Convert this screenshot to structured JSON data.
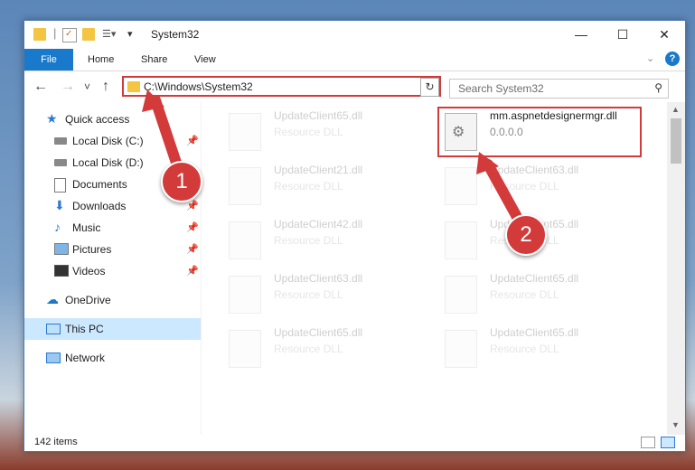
{
  "window": {
    "title": "System32",
    "controls": {
      "minimize": "—",
      "maximize": "☐",
      "close": "✕"
    }
  },
  "ribbon": {
    "file": "File",
    "tabs": [
      "Home",
      "Share",
      "View"
    ]
  },
  "nav": {
    "back": "←",
    "forward": "→",
    "recent": "˅",
    "up": "↑",
    "address": "C:\\Windows\\System32",
    "refresh": "↻",
    "search_placeholder": "Search System32"
  },
  "sidebar": {
    "quick_access": "Quick access",
    "items": [
      {
        "label": "Local Disk (C:)",
        "icon": "drive-icon"
      },
      {
        "label": "Local Disk (D:)",
        "icon": "drive-icon"
      },
      {
        "label": "Documents",
        "icon": "documents-icon"
      },
      {
        "label": "Downloads",
        "icon": "downloads-icon"
      },
      {
        "label": "Music",
        "icon": "music-icon"
      },
      {
        "label": "Pictures",
        "icon": "pictures-icon"
      },
      {
        "label": "Videos",
        "icon": "videos-icon"
      }
    ],
    "onedrive": "OneDrive",
    "this_pc": "This PC",
    "network": "Network"
  },
  "files": {
    "left": [
      {
        "name": "UpdateClient65.dll",
        "desc": "Resource DLL"
      },
      {
        "name": "UpdateClient21.dll",
        "desc": "Resource DLL"
      },
      {
        "name": "UpdateClient42.dll",
        "desc": "Resource DLL"
      },
      {
        "name": "UpdateClient63.dll",
        "desc": "Resource DLL"
      },
      {
        "name": "UpdateClient65.dll",
        "desc": "Resource DLL"
      }
    ],
    "right": [
      {
        "name": "mm.aspnetdesignermgr.dll",
        "desc": "0.0.0.0"
      },
      {
        "name": "UpdateClient63.dll",
        "desc": "Resource DLL"
      },
      {
        "name": "UpdateClient65.dll",
        "desc": "Resource DLL"
      },
      {
        "name": "UpdateClient65.dll",
        "desc": "Resource DLL"
      },
      {
        "name": "UpdateClient65.dll",
        "desc": "Resource DLL"
      }
    ]
  },
  "status": {
    "count": "142 items"
  },
  "annotations": {
    "step1": "1",
    "step2": "2"
  },
  "colors": {
    "accent": "#1979ca",
    "highlight": "#d33b3b"
  }
}
